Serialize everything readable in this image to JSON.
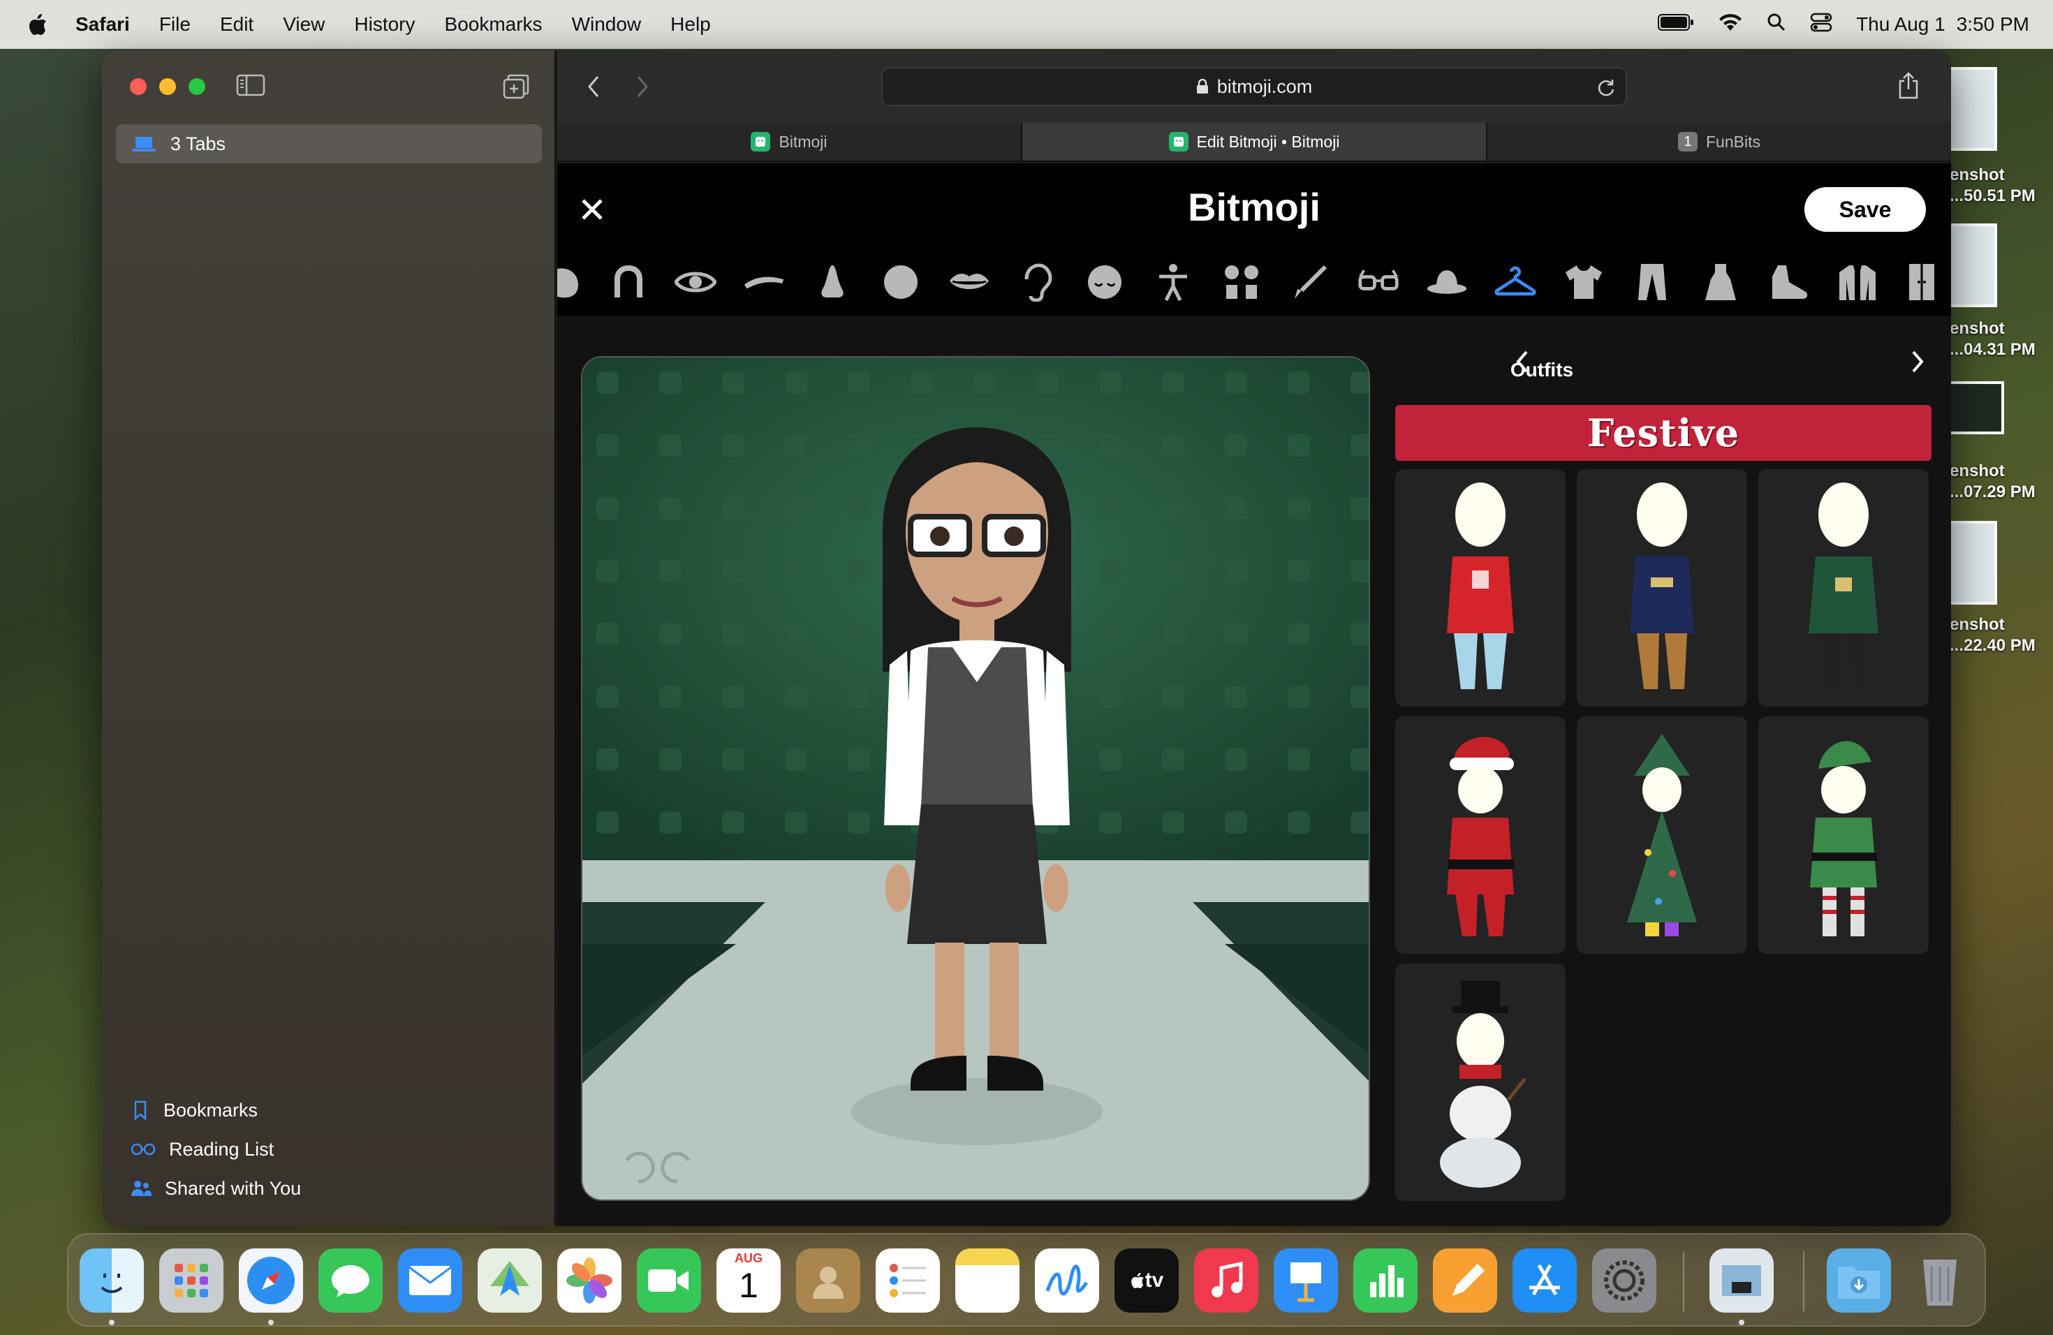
{
  "menubar": {
    "app": "Safari",
    "items": [
      "File",
      "Edit",
      "View",
      "History",
      "Bookmarks",
      "Window",
      "Help"
    ],
    "date": "Thu Aug 1",
    "time": "3:50 PM"
  },
  "desktop_files": [
    {
      "line1": "enshot",
      "line2": "...50.51 PM"
    },
    {
      "line1": "enshot",
      "line2": "...04.31 PM"
    },
    {
      "line1": "enshot",
      "line2": "...07.29 PM"
    },
    {
      "line1": "enshot",
      "line2": "...22.40 PM"
    }
  ],
  "sidebar": {
    "tab_group": "3 Tabs",
    "links": [
      "Bookmarks",
      "Reading List",
      "Shared with You"
    ]
  },
  "browser": {
    "url": "bitmoji.com",
    "tabs": [
      {
        "label": "Bitmoji",
        "active": false,
        "badge": ""
      },
      {
        "label": "Edit Bitmoji • Bitmoji",
        "active": true,
        "badge": ""
      },
      {
        "label": "FunBits",
        "active": false,
        "badge": "1"
      }
    ]
  },
  "bitmoji": {
    "title": "Bitmoji",
    "save": "Save",
    "categories": [
      "face-shape",
      "hair",
      "eyes",
      "eyebrows",
      "nose",
      "head",
      "lips",
      "ear",
      "face-lines",
      "body",
      "accessories",
      "makeup",
      "glasses",
      "hat",
      "outfits",
      "tops",
      "bottoms",
      "dresses",
      "shoes",
      "outerwear",
      "door"
    ],
    "active_category": "outfits",
    "panel_title": "Outfits",
    "banner": "Festive",
    "outfits": [
      "red-sweater",
      "navy-sweater",
      "green-sweater",
      "santa-suit",
      "christmas-tree",
      "elf-costume",
      "snowman"
    ]
  },
  "dock": {
    "calendar_month": "AUG",
    "calendar_day": "1",
    "tv_label": "tv"
  }
}
